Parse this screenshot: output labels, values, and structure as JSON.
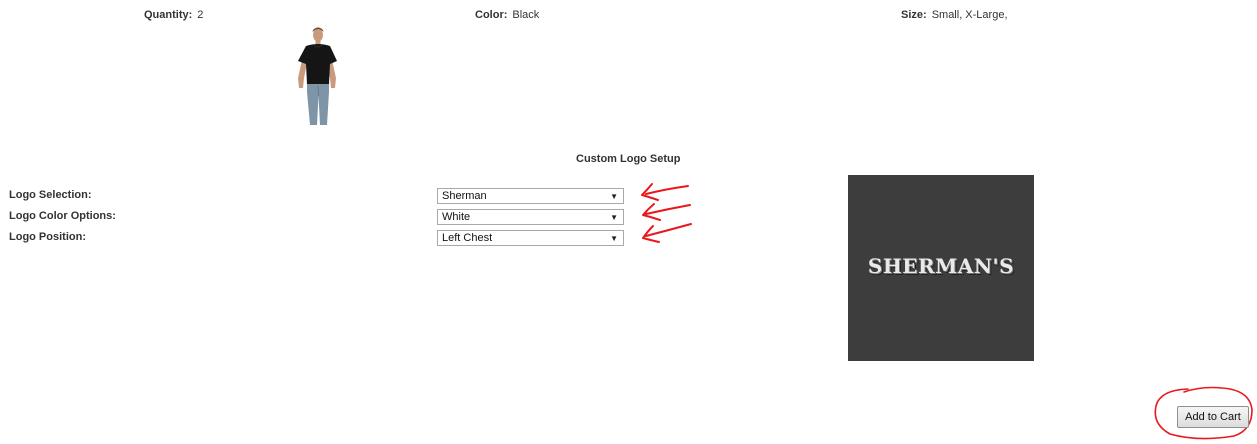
{
  "summary": {
    "quantity_label": "Quantity:",
    "quantity_value": "2",
    "color_label": "Color:",
    "color_value": "Black",
    "size_label": "Size:",
    "size_value": "Small, X-Large,"
  },
  "product": {
    "shirt_color": "#151515"
  },
  "logo_setup": {
    "title": "Custom Logo Setup",
    "options": [
      {
        "label": "Logo Selection:",
        "value": "Sherman"
      },
      {
        "label": "Logo Color Options:",
        "value": "White"
      },
      {
        "label": "Logo Position:",
        "value": "Left Chest"
      }
    ],
    "preview_text": "SHERMAN'S",
    "preview_bg": "#3d3d3d"
  },
  "actions": {
    "add_to_cart": "Add to Cart"
  },
  "annotations": {
    "color": "#e8181c"
  }
}
